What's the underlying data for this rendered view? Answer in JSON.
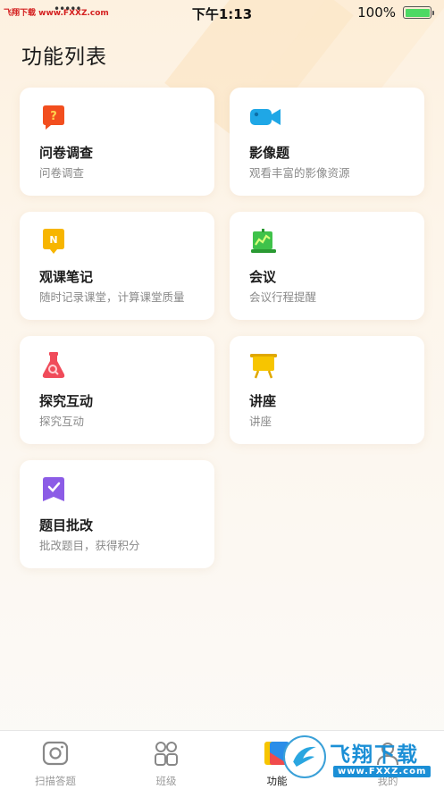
{
  "status_bar": {
    "watermark": "飞翔下载 www.FXXZ.com",
    "carrier": "•••••",
    "time": "下午1:13",
    "battery_pct": "100%"
  },
  "page": {
    "title": "功能列表"
  },
  "features": [
    {
      "title": "问卷调查",
      "subtitle": "问卷调查",
      "icon": "questionnaire-icon",
      "color": "#f24e1e"
    },
    {
      "title": "影像题",
      "subtitle": "观看丰富的影像资源",
      "icon": "video-camera-icon",
      "color": "#1fa7e6"
    },
    {
      "title": "观课笔记",
      "subtitle": "随时记录课堂，计算课堂质量",
      "icon": "notebook-icon",
      "color": "#f7b500"
    },
    {
      "title": "会议",
      "subtitle": "会议行程提醒",
      "icon": "meeting-board-icon",
      "color": "#3fc24a"
    },
    {
      "title": "探究互动",
      "subtitle": "探究互动",
      "icon": "flask-icon",
      "color": "#f04b5a"
    },
    {
      "title": "讲座",
      "subtitle": "讲座",
      "icon": "lecture-board-icon",
      "color": "#f7c500"
    },
    {
      "title": "题目批改",
      "subtitle": "批改题目，获得积分",
      "icon": "grading-icon",
      "color": "#8c5ce6"
    }
  ],
  "tabs": [
    {
      "label": "扫描答题",
      "icon": "camera-icon",
      "active": false
    },
    {
      "label": "班级",
      "icon": "class-icon",
      "active": false
    },
    {
      "label": "功能",
      "icon": "function-icon",
      "active": true
    },
    {
      "label": "我的",
      "icon": "profile-icon",
      "active": false
    }
  ],
  "watermark_badge": {
    "name": "飞翔下载",
    "url": "www.FXXZ.com"
  }
}
